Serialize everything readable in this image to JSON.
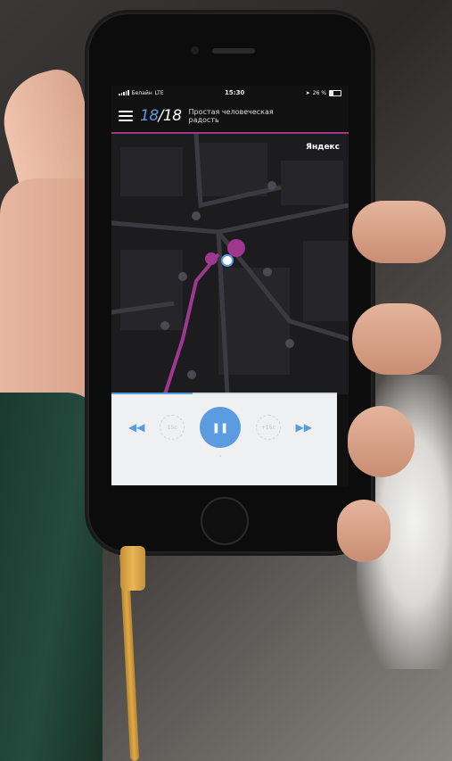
{
  "status_bar": {
    "carrier": "Белайн",
    "network": "LTE",
    "time": "15:30",
    "battery": "26 %"
  },
  "app_bar": {
    "counter_current": "18",
    "counter_separator": "/",
    "counter_total": "18",
    "track_title": "Простая человеческая радость"
  },
  "map": {
    "brand": "Яндекс",
    "route_color": "#a0378e",
    "accent_color": "#5b9be0"
  },
  "player": {
    "skip_back_label": "15с",
    "skip_forward_label": "+15с"
  }
}
